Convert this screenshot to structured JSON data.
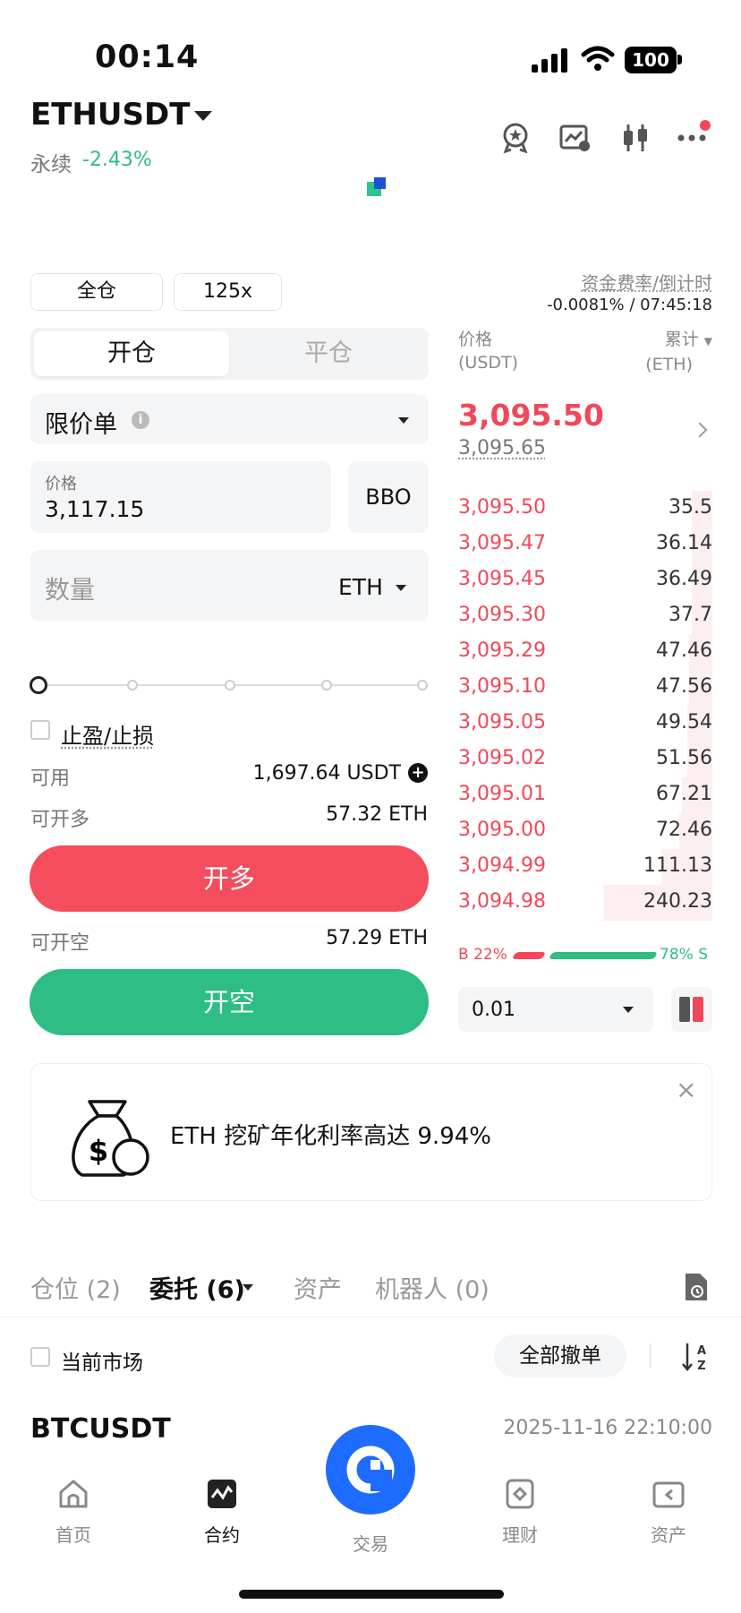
{
  "status_bar": {
    "time": "00:14",
    "battery": "100"
  },
  "header": {
    "symbol": "ETHUSDT",
    "contract_type": "永续",
    "change": "-2.43%"
  },
  "margin": {
    "mode": "全仓",
    "leverage": "125x"
  },
  "funding": {
    "label": "资金费率/倒计时",
    "value": "-0.0081% / 07:45:18"
  },
  "trade_tabs": {
    "open": "开仓",
    "close": "平仓"
  },
  "order_type": {
    "label": "限价单",
    "info": "i"
  },
  "price": {
    "label": "价格",
    "value": "3,117.15",
    "bbo": "BBO"
  },
  "quantity": {
    "placeholder": "数量",
    "unit": "ETH"
  },
  "slider": {
    "percent": 0
  },
  "tpsl": {
    "label": "止盈/止损"
  },
  "available": {
    "label": "可用",
    "value": "1,697.64 USDT"
  },
  "long_max": {
    "label": "可开多",
    "value": "57.32 ETH"
  },
  "short_max": {
    "label": "可开空",
    "value": "57.29 ETH"
  },
  "buttons": {
    "long": "开多",
    "short": "开空"
  },
  "orderbook": {
    "price_header": "价格",
    "price_unit": "(USDT)",
    "qty_header": "累计",
    "qty_unit": "(ETH)",
    "last_price": "3,095.50",
    "mark_price": "3,095.65",
    "asks": [
      {
        "price": "3,095.50",
        "qty": "35.5"
      },
      {
        "price": "3,095.47",
        "qty": "36.14"
      },
      {
        "price": "3,095.45",
        "qty": "36.49"
      },
      {
        "price": "3,095.30",
        "qty": "37.7"
      },
      {
        "price": "3,095.29",
        "qty": "47.46"
      },
      {
        "price": "3,095.10",
        "qty": "47.56"
      },
      {
        "price": "3,095.05",
        "qty": "49.54"
      },
      {
        "price": "3,095.02",
        "qty": "51.56"
      },
      {
        "price": "3,095.01",
        "qty": "67.21"
      },
      {
        "price": "3,095.00",
        "qty": "72.46"
      },
      {
        "price": "3,094.99",
        "qty": "111.13"
      },
      {
        "price": "3,094.98",
        "qty": "240.23"
      }
    ],
    "buy_ratio": "B 22%",
    "sell_ratio": "78% S",
    "precision": "0.01"
  },
  "promo": {
    "text": "ETH 挖矿年化利率高达 9.94%",
    "close": "×"
  },
  "tabs": [
    {
      "label": "仓位 (2)"
    },
    {
      "label": "委托 (6)"
    },
    {
      "label": "资产"
    },
    {
      "label": "机器人 (0)"
    }
  ],
  "orders": {
    "filter_label": "当前市场",
    "cancel_all": "全部撤单",
    "first_symbol": "BTCUSDT",
    "first_time": "2025-11-16 22:10:00"
  },
  "nav": [
    {
      "label": "首页",
      "icon": "home-icon"
    },
    {
      "label": "合约",
      "icon": "futures-icon"
    },
    {
      "label": "交易",
      "icon": "trade-icon"
    },
    {
      "label": "理财",
      "icon": "earn-icon"
    },
    {
      "label": "资产",
      "icon": "wallet-icon"
    }
  ],
  "colors": {
    "up": "#2ebd85",
    "down": "#f0485a",
    "brand": "#1e6bff"
  }
}
